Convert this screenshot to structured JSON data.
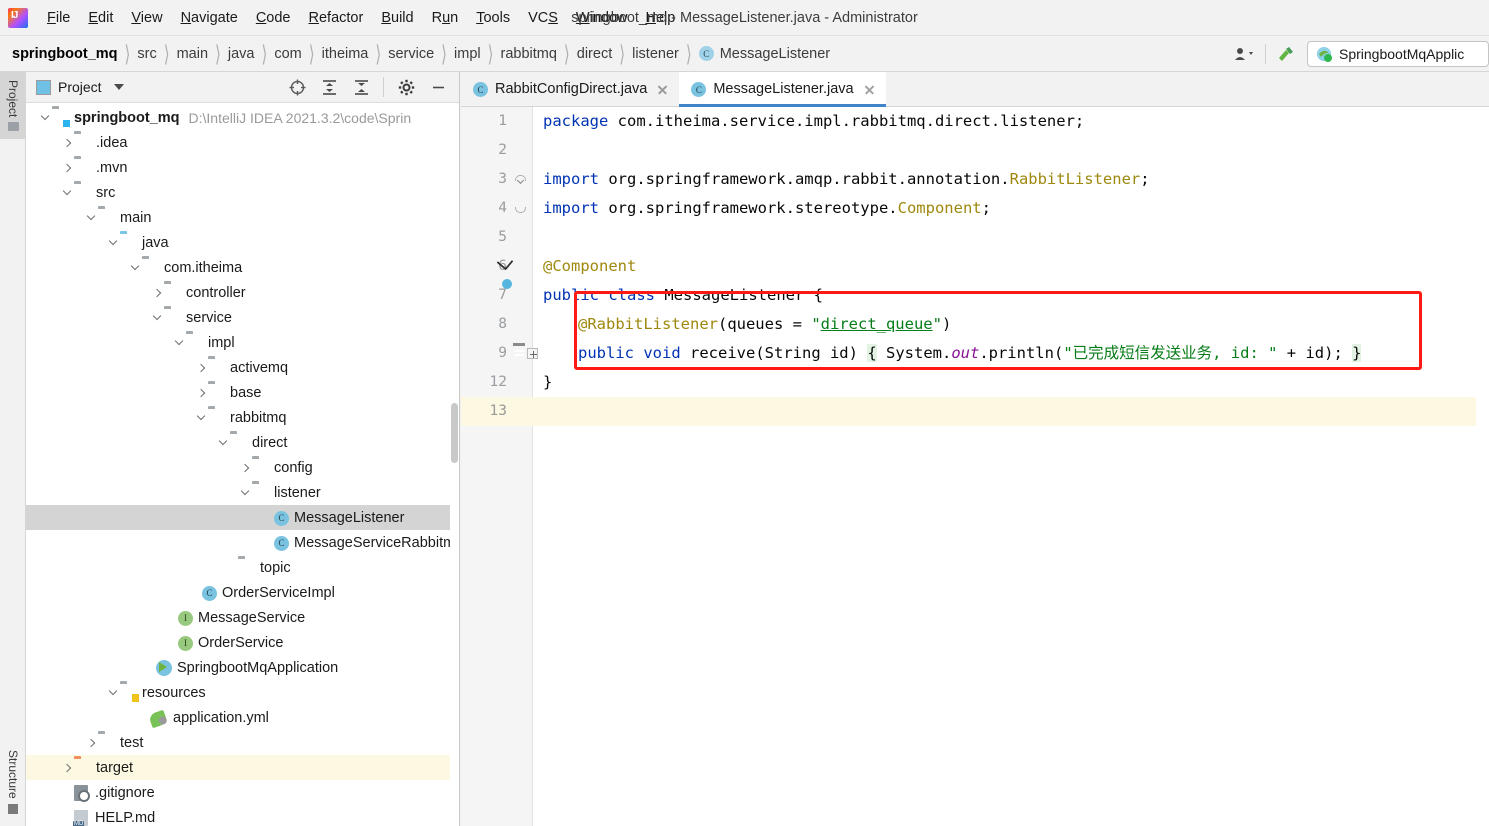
{
  "window": {
    "title": "springboot_mq - MessageListener.java - Administrator",
    "app_icon": "intellij-idea-icon"
  },
  "menubar": {
    "items": [
      {
        "label": "File",
        "mnemonic": "F"
      },
      {
        "label": "Edit",
        "mnemonic": "E"
      },
      {
        "label": "View",
        "mnemonic": "V"
      },
      {
        "label": "Navigate",
        "mnemonic": "N"
      },
      {
        "label": "Code",
        "mnemonic": "C"
      },
      {
        "label": "Refactor",
        "mnemonic": "R"
      },
      {
        "label": "Build",
        "mnemonic": "B"
      },
      {
        "label": "Run",
        "mnemonic": "u"
      },
      {
        "label": "Tools",
        "mnemonic": "T"
      },
      {
        "label": "VCS",
        "mnemonic": "S"
      },
      {
        "label": "Window",
        "mnemonic": "W"
      },
      {
        "label": "Help",
        "mnemonic": "H"
      }
    ]
  },
  "navbar": {
    "breadcrumbs": [
      "springboot_mq",
      "src",
      "main",
      "java",
      "com",
      "itheima",
      "service",
      "impl",
      "rabbitmq",
      "direct",
      "listener"
    ],
    "current_class": "MessageListener",
    "current_class_icon": "class-icon",
    "actions": [
      {
        "name": "user-settings-icon",
        "glyph": " "
      },
      {
        "name": "build-hammer-icon",
        "glyph": " "
      }
    ],
    "run_config": {
      "label": "SpringbootMqApplic",
      "icon": "spring-boot-run-icon"
    }
  },
  "tool_stripes": {
    "left": [
      {
        "label": "Project",
        "icon": "folder-icon",
        "active": true
      },
      {
        "label": "Structure",
        "icon": "structure-icon",
        "active": false
      }
    ]
  },
  "project_panel": {
    "title": "Project",
    "title_icon": "project-view-icon",
    "dropdown_icon": "chevron-down-icon",
    "toolbar": [
      {
        "name": "locate-file-icon"
      },
      {
        "name": "expand-all-icon"
      },
      {
        "name": "collapse-all-icon"
      },
      {
        "name": "settings-gear-icon"
      },
      {
        "name": "hide-panel-icon"
      }
    ],
    "tree": [
      {
        "label": "springboot_mq",
        "path_hint": "D:\\IntelliJ IDEA 2021.3.2\\code\\Sprin",
        "icon": "module-folder-icon",
        "depth": 0,
        "arrow": "down",
        "bold": true
      },
      {
        "label": ".idea",
        "icon": "folder-icon",
        "depth": 1,
        "arrow": "right"
      },
      {
        "label": ".mvn",
        "icon": "folder-icon",
        "depth": 1,
        "arrow": "right"
      },
      {
        "label": "src",
        "icon": "folder-icon",
        "depth": 1,
        "arrow": "down"
      },
      {
        "label": "main",
        "icon": "folder-icon",
        "depth": 2,
        "arrow": "down"
      },
      {
        "label": "java",
        "icon": "source-root-folder-icon",
        "depth": 3,
        "arrow": "down"
      },
      {
        "label": "com.itheima",
        "icon": "package-icon",
        "depth": 4,
        "arrow": "down"
      },
      {
        "label": "controller",
        "icon": "package-icon",
        "depth": 5,
        "arrow": "right"
      },
      {
        "label": "service",
        "icon": "package-icon",
        "depth": 5,
        "arrow": "down"
      },
      {
        "label": "impl",
        "icon": "package-icon",
        "depth": 6,
        "arrow": "down"
      },
      {
        "label": "activemq",
        "icon": "package-icon",
        "depth": 7,
        "arrow": "right"
      },
      {
        "label": "base",
        "icon": "package-icon",
        "depth": 7,
        "arrow": "right"
      },
      {
        "label": "rabbitmq",
        "icon": "package-icon",
        "depth": 7,
        "arrow": "down"
      },
      {
        "label": "direct",
        "icon": "package-icon",
        "depth": 8,
        "arrow": "down"
      },
      {
        "label": "config",
        "icon": "package-icon",
        "depth": 9,
        "arrow": "right"
      },
      {
        "label": "listener",
        "icon": "package-icon",
        "depth": 9,
        "arrow": "down"
      },
      {
        "label": "MessageListener",
        "icon": "class-icon",
        "depth": 10,
        "arrow": "none",
        "selected": true
      },
      {
        "label": "MessageServiceRabbitm",
        "icon": "class-icon",
        "depth": 10,
        "arrow": "none"
      },
      {
        "label": "topic",
        "icon": "package-icon",
        "depth": 8,
        "arrow": "none"
      },
      {
        "label": "OrderServiceImpl",
        "icon": "class-icon",
        "depth": 7,
        "arrow": "none"
      },
      {
        "label": "MessageService",
        "icon": "interface-icon",
        "depth": 6,
        "arrow": "none"
      },
      {
        "label": "OrderService",
        "icon": "interface-icon",
        "depth": 6,
        "arrow": "none"
      },
      {
        "label": "SpringbootMqApplication",
        "icon": "spring-boot-class-icon",
        "depth": 5,
        "arrow": "none"
      },
      {
        "label": "resources",
        "icon": "resources-folder-icon",
        "depth": 3,
        "arrow": "down"
      },
      {
        "label": "application.yml",
        "icon": "spring-yaml-icon",
        "depth": 4,
        "arrow": "none"
      },
      {
        "label": "test",
        "icon": "folder-icon",
        "depth": 2,
        "arrow": "right"
      },
      {
        "label": "target",
        "icon": "excluded-folder-icon",
        "depth": 1,
        "arrow": "right",
        "highlighted": true
      },
      {
        "label": ".gitignore",
        "icon": "gitignore-file-icon",
        "depth": 1,
        "arrow": "none"
      },
      {
        "label": "HELP.md",
        "icon": "markdown-file-icon",
        "depth": 1,
        "arrow": "none"
      }
    ]
  },
  "editor": {
    "tabs": [
      {
        "label": "RabbitConfigDirect.java",
        "icon": "class-icon",
        "active": false,
        "close_icon": "close-icon"
      },
      {
        "label": "MessageListener.java",
        "icon": "class-icon",
        "active": true,
        "close_icon": "close-icon"
      }
    ],
    "lines": [
      {
        "num": "1",
        "gutter": "fold-start",
        "tokens": [
          {
            "t": "package",
            "c": "kw"
          },
          {
            "t": " com.itheima.service.impl.rabbitmq.direct.listener;",
            "c": "plain"
          }
        ]
      },
      {
        "num": "2",
        "gutter": "",
        "tokens": []
      },
      {
        "num": "3",
        "gutter": "fold-a",
        "tokens": [
          {
            "t": "import",
            "c": "kw"
          },
          {
            "t": " org.springframework.amqp.rabbit.annotation.",
            "c": "plain"
          },
          {
            "t": "RabbitListener",
            "c": "ann"
          },
          {
            "t": ";",
            "c": "plain"
          }
        ]
      },
      {
        "num": "4",
        "gutter": "fold-b",
        "tokens": [
          {
            "t": "import",
            "c": "kw"
          },
          {
            "t": " org.springframework.stereotype.",
            "c": "plain"
          },
          {
            "t": "Component",
            "c": "ann"
          },
          {
            "t": ";",
            "c": "plain"
          }
        ]
      },
      {
        "num": "5",
        "gutter": "",
        "tokens": []
      },
      {
        "num": "6",
        "gutter": "bean-marker",
        "tokens": [
          {
            "t": "@Component",
            "c": "ann"
          }
        ]
      },
      {
        "num": "7",
        "gutter": "bean-class-marker",
        "tokens": [
          {
            "t": "public",
            "c": "kw"
          },
          {
            "t": " ",
            "c": "plain"
          },
          {
            "t": "class",
            "c": "kw"
          },
          {
            "t": " MessageListener {",
            "c": "plain"
          }
        ]
      },
      {
        "num": "8",
        "gutter": "",
        "indent": 1,
        "tokens": [
          {
            "t": "@RabbitListener",
            "c": "ann"
          },
          {
            "t": "(queues = ",
            "c": "plain"
          },
          {
            "t": "\"",
            "c": "str"
          },
          {
            "t": "direct_queue",
            "c": "strq"
          },
          {
            "t": "\"",
            "c": "str"
          },
          {
            "t": ")",
            "c": "plain"
          }
        ]
      },
      {
        "num": "9",
        "gutter": "listener-marker",
        "indent": 1,
        "fold_plus": true,
        "tokens": [
          {
            "t": "public",
            "c": "kw"
          },
          {
            "t": " ",
            "c": "plain"
          },
          {
            "t": "void",
            "c": "kw"
          },
          {
            "t": " receive(String id) ",
            "c": "plain"
          },
          {
            "t": "{",
            "c": "brace"
          },
          {
            "t": " System.",
            "c": "plain"
          },
          {
            "t": "out",
            "c": "fld"
          },
          {
            "t": ".println(",
            "c": "plain"
          },
          {
            "t": "\"已完成短信发送业务, id: \"",
            "c": "str"
          },
          {
            "t": " + id);",
            "c": "plain"
          },
          {
            "t": " ",
            "c": "plain"
          },
          {
            "t": "}",
            "c": "brace"
          }
        ]
      },
      {
        "num": "12",
        "gutter": "",
        "tokens": [
          {
            "t": "}",
            "c": "plain"
          }
        ]
      },
      {
        "num": "13",
        "gutter": "",
        "highlighted": true,
        "tokens": []
      }
    ],
    "annotation_box": {
      "name": "red-highlight-box",
      "color": "#ff1a13",
      "covers_lines": [
        "8",
        "9"
      ]
    }
  }
}
